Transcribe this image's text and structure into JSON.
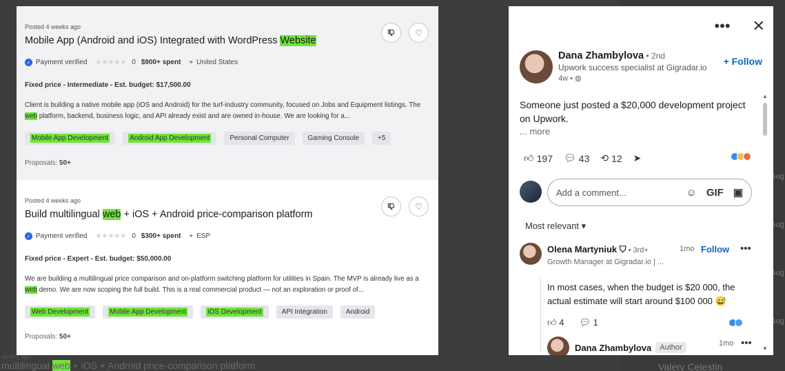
{
  "jobs": [
    {
      "posted": "Posted 4 weeks ago",
      "title_pre": "Mobile App (Android and iOS) Integrated with WordPress ",
      "title_hl": "Website",
      "title_post": "",
      "payment": "Payment verified",
      "rating": "0",
      "spent": "$900+ spent",
      "location": "United States",
      "budget_type": "Fixed price - Intermediate - Est. budget: ",
      "budget": "$17,500.00",
      "desc_1": "Client is building a native mobile app (iOS and Android) for the turf-industry community, focused on Jobs and Equipment listings. The ",
      "desc_hl": "web",
      "desc_2": " platform, backend, business logic, and API already exist and are owned in-house. We are looking for a...",
      "tags_highlighted": [
        "Mobile App Development",
        "Android App Development"
      ],
      "tags_plain": [
        "Personal Computer",
        "Gaming Console",
        "+5"
      ],
      "proposals_label": "Proposals: ",
      "proposals": "50+"
    },
    {
      "posted": "Posted 4 weeks ago",
      "title_pre": "Build multilingual ",
      "title_hl": "web",
      "title_post": " + iOS + Android price-comparison platform",
      "payment": "Payment verified",
      "rating": "0",
      "spent": "$300+ spent",
      "location": "ESP",
      "budget_type": "Fixed price - Expert - Est. budget: ",
      "budget": "$50,000.00",
      "desc_1": "We are building a multilingual price comparison and on-platform switching platform for utilities in Spain. The MVP is already live as a ",
      "desc_hl": "web",
      "desc_2": " demo. We are now scoping the full build. This is a real commercial product — not an exploration or proof of...",
      "tags_highlighted": [
        "Web Development",
        "Mobile App Development",
        "iOS Development"
      ],
      "tags_plain": [
        "API Integration",
        "Android"
      ],
      "proposals_label": "Proposals: ",
      "proposals": "50+"
    }
  ],
  "background": {
    "peek_posted": "weeks ago",
    "peek_title_pre": "multilingual ",
    "peek_title_hl": "web",
    "peek_title_post": " + iOS + Android price-comparison platform",
    "peek_right": "Valery Celestin",
    "aug_label": "Aug"
  },
  "post": {
    "author_name": "Dana Zhambylova",
    "author_degree": " • 2nd",
    "author_headline": "Upwork success specialist at Gigradar.io",
    "author_time": "4w • ",
    "follow_label": "+ Follow",
    "text": "Someone just posted a $20,000 development project on Upwork.",
    "more_label": "... more",
    "likes": "197",
    "comments": "43",
    "reposts": "12",
    "comment_placeholder": "Add a comment...",
    "gif_label": "GIF",
    "sort_label": "Most relevant ▾",
    "comment": {
      "name": "Olena Martyniuk",
      "degree": " • 3rd+",
      "time": "1mo",
      "follow_label": "Follow",
      "headline": "Growth Manager at Gigradar.io | ...",
      "body": "In most cases, when the budget is $20 000, the actual estimate will start around $100 000 😅",
      "likes": "4",
      "replies": "1"
    },
    "reply": {
      "name": "Dana Zhambylova",
      "tag": "Author",
      "time": "1mo"
    }
  }
}
